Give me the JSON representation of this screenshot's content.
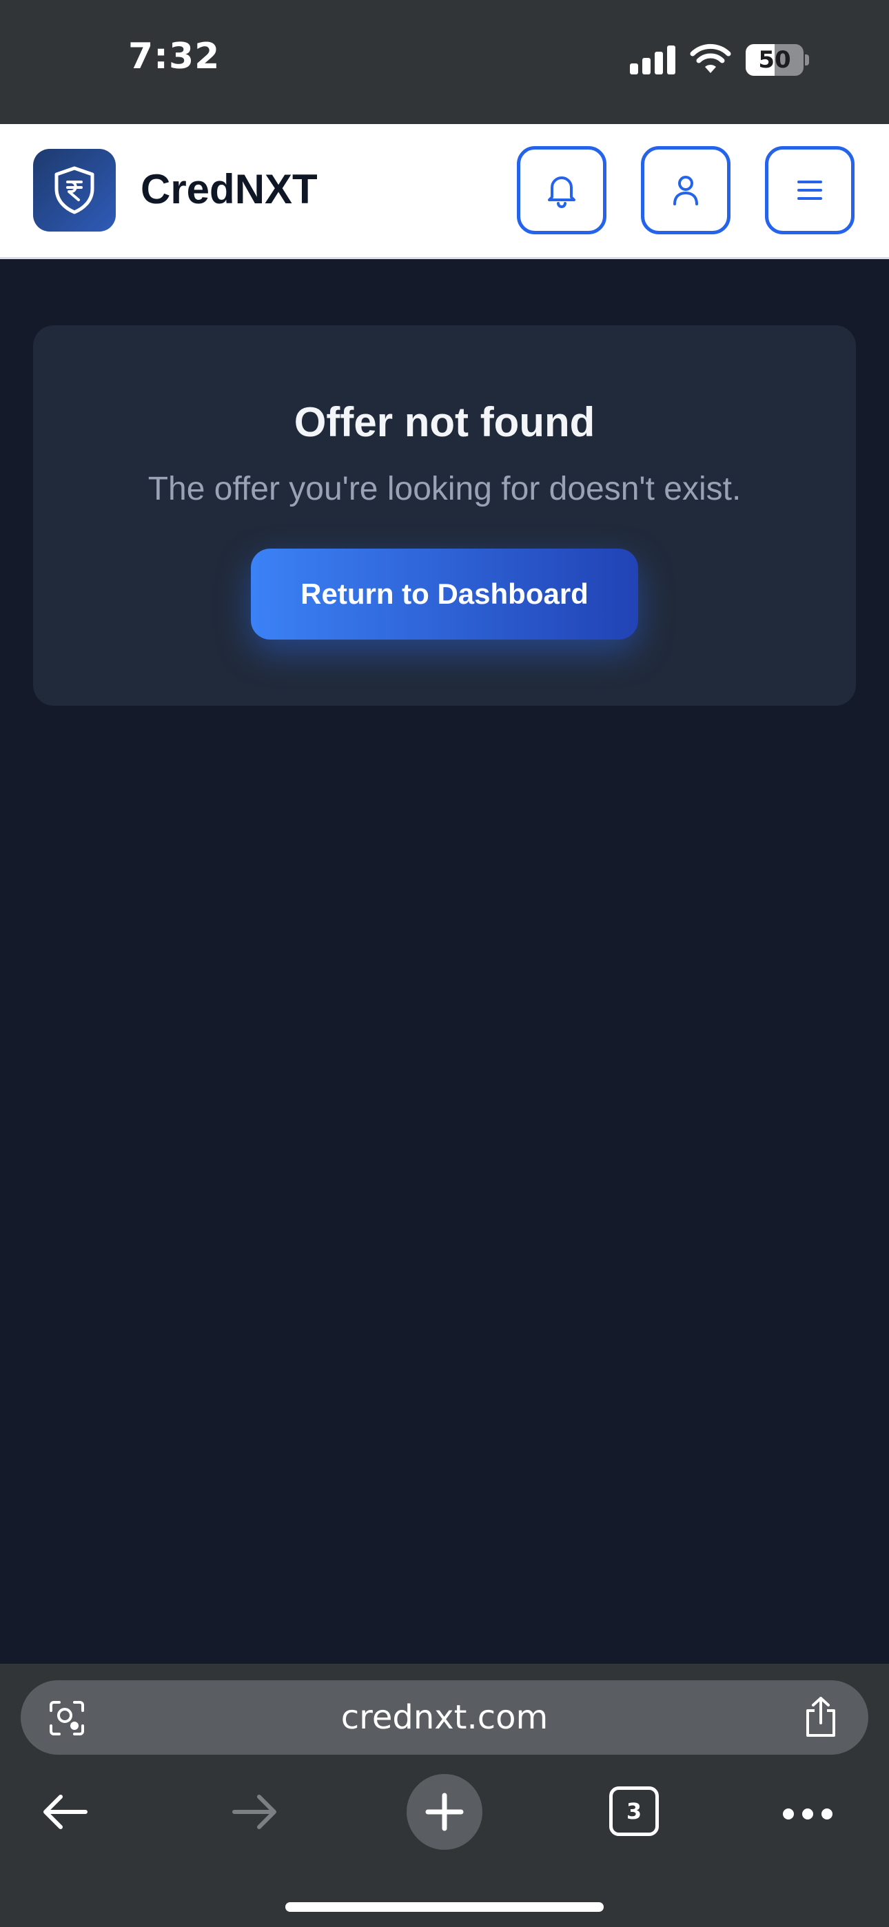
{
  "status_bar": {
    "time": "7:32",
    "battery_percent": "50",
    "battery_level": 0.5,
    "icons": [
      "cellular-signal-icon",
      "wifi-icon",
      "battery-icon"
    ]
  },
  "header": {
    "brand": "CredNXT",
    "logo_icon": "shield-rupee-icon",
    "buttons": [
      {
        "name": "notifications-button",
        "icon": "bell-icon"
      },
      {
        "name": "profile-button",
        "icon": "user-icon"
      },
      {
        "name": "menu-button",
        "icon": "hamburger-menu-icon"
      }
    ],
    "accent_color": "#2563eb"
  },
  "main": {
    "title": "Offer not found",
    "message": "The offer you're looking for doesn't exist.",
    "cta_label": "Return to Dashboard"
  },
  "browser": {
    "url": "crednxt.com",
    "tab_count": "3",
    "icons": [
      "visual-lookup-icon",
      "share-icon",
      "back-arrow-icon",
      "forward-arrow-icon",
      "new-tab-plus-icon",
      "tabs-icon",
      "more-icon"
    ]
  },
  "colors": {
    "page_background": "#141a2a",
    "card_background": "#212a3a",
    "cta_gradient_start": "#3b82f6",
    "cta_gradient_end": "#2143b5"
  }
}
